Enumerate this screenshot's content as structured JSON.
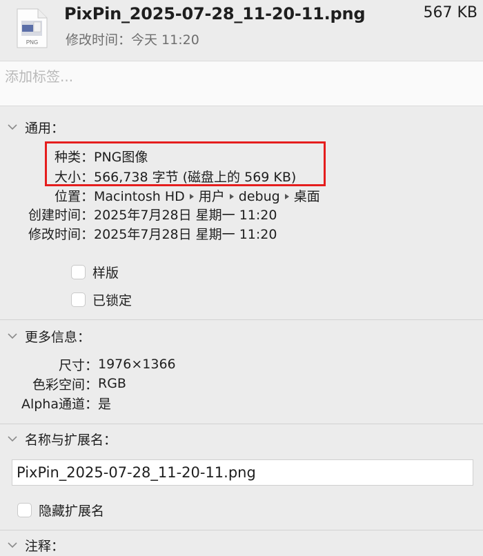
{
  "header": {
    "file_name": "PixPin_2025-07-28_11-20-11.png",
    "file_size": "567 KB",
    "modified_label": "修改时间：",
    "modified_value": "今天 11:20",
    "icon_caption": "PNG"
  },
  "tags": {
    "placeholder": "添加标签..."
  },
  "general": {
    "title": "通用：",
    "kind_label": "种类：",
    "kind_value": "PNG图像",
    "size_label": "大小：",
    "size_value": "566,738 字节 (磁盘上的 569 KB)",
    "where_label": "位置：",
    "where_path": [
      "Macintosh HD",
      "用户",
      "debug",
      "桌面"
    ],
    "created_label": "创建时间：",
    "created_value": "2025年7月28日 星期一 11:20",
    "modified_label": "修改时间：",
    "modified_value": "2025年7月28日 星期一 11:20",
    "stationery_label": "样版",
    "locked_label": "已锁定"
  },
  "more_info": {
    "title": "更多信息：",
    "dimensions_label": "尺寸：",
    "dimensions_value": "1976×1366",
    "color_space_label": "色彩空间：",
    "color_space_value": "RGB",
    "alpha_label": "Alpha通道：",
    "alpha_value": "是"
  },
  "name_ext": {
    "title": "名称与扩展名：",
    "name_value": "PixPin_2025-07-28_11-20-11.png",
    "hide_ext_label": "隐藏扩展名"
  },
  "comments": {
    "title": "注释："
  },
  "colors": {
    "highlight": "#e51d1d",
    "background": "#ececec"
  }
}
